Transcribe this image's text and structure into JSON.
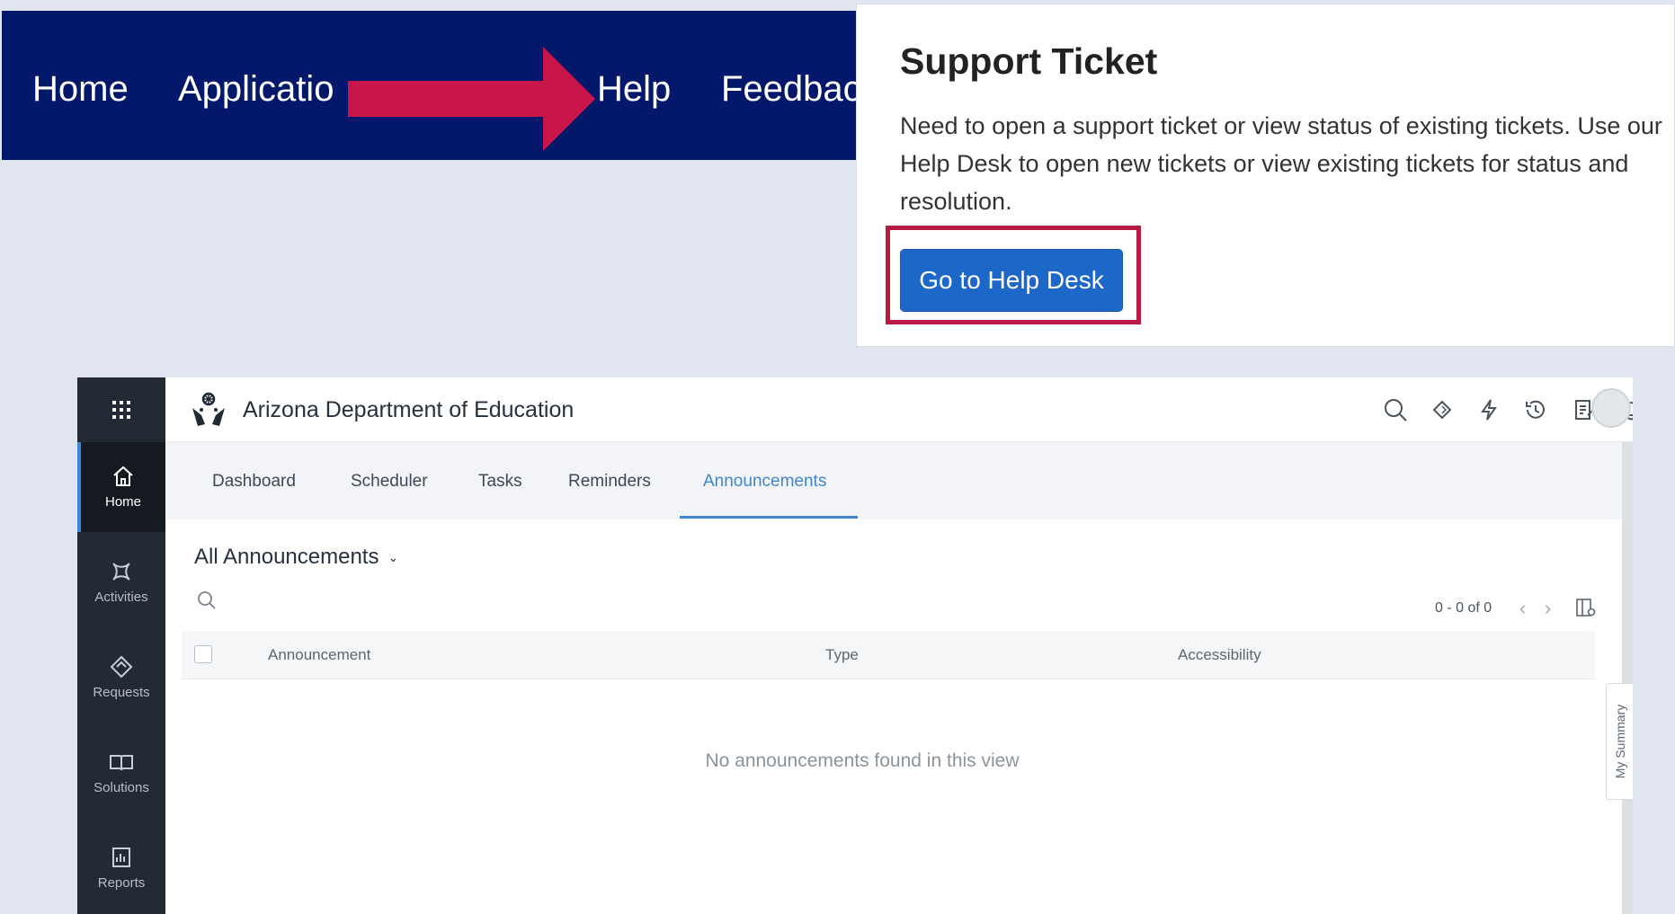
{
  "top_nav": {
    "items": [
      "Home",
      "Applicatio",
      "Help",
      "Feedbac"
    ],
    "background": "#04186b",
    "annotation_color": "#c8164a"
  },
  "support_ticket": {
    "title": "Support Ticket",
    "description": "Need to open a support ticket or view status of existing tickets. Use our Help Desk to open new tickets or view existing tickets for status and resolution.",
    "button_label": "Go to Help Desk",
    "button_color": "#1d67c9",
    "highlight_color": "#b81a43"
  },
  "app": {
    "org_name": "Arizona Department of Education",
    "header_icons": [
      "search-icon",
      "diamond-sparkle-icon",
      "lightning-icon",
      "history-icon",
      "notes-icon",
      "bell-icon",
      "avatar"
    ],
    "rail": [
      {
        "label": "Home",
        "icon": "home-icon",
        "active": true
      },
      {
        "label": "Activities",
        "icon": "activities-icon",
        "active": false
      },
      {
        "label": "Requests",
        "icon": "requests-icon",
        "active": false
      },
      {
        "label": "Solutions",
        "icon": "solutions-icon",
        "active": false
      },
      {
        "label": "Reports",
        "icon": "reports-icon",
        "active": false
      }
    ],
    "tabs": [
      "Dashboard",
      "Scheduler",
      "Tasks",
      "Reminders",
      "Announcements"
    ],
    "active_tab": "Announcements",
    "filter_label": "All Announcements",
    "pager_text": "0 - 0 of 0",
    "columns": [
      "Announcement",
      "Type",
      "Accessibility"
    ],
    "empty_message": "No announcements found in this view",
    "side_tab": "My Summary",
    "accent": "#3f86cf"
  }
}
